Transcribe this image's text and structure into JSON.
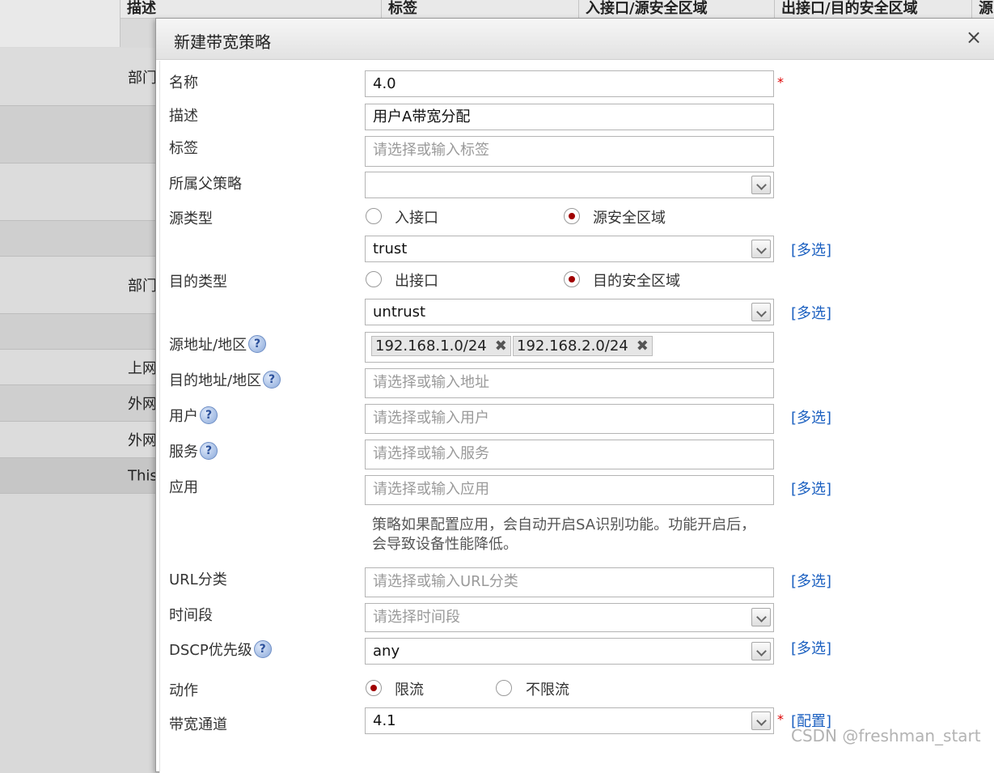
{
  "background_table": {
    "headers": [
      "描述",
      "标签",
      "入接口/源安全区域",
      "出接口/目的安全区域",
      "源"
    ],
    "rows": [
      {
        "text": ""
      },
      {
        "text": "部门"
      },
      {
        "text": ""
      },
      {
        "text": ""
      },
      {
        "text": ""
      },
      {
        "text": "部门"
      },
      {
        "text": ""
      },
      {
        "text": "上网"
      },
      {
        "text": "外网"
      },
      {
        "text": "外网"
      },
      {
        "text": "This"
      }
    ]
  },
  "dialog": {
    "title": "新建带宽策略",
    "close_glyph": "×"
  },
  "form": {
    "name": {
      "label": "名称",
      "value": "4.0",
      "required": "*"
    },
    "description": {
      "label": "描述",
      "value": "用户A带宽分配"
    },
    "tags": {
      "label": "标签",
      "placeholder": "请选择或输入标签"
    },
    "parent_policy": {
      "label": "所属父策略",
      "value": ""
    },
    "source_type": {
      "label": "源类型",
      "options": [
        "入接口",
        "源安全区域"
      ],
      "selected": "源安全区域",
      "zone_value": "trust",
      "multi_link": "[多选]"
    },
    "dest_type": {
      "label": "目的类型",
      "options": [
        "出接口",
        "目的安全区域"
      ],
      "selected": "目的安全区域",
      "zone_value": "untrust",
      "multi_link": "[多选]"
    },
    "source_address": {
      "label": "源地址/地区",
      "tags": [
        "192.168.1.0/24",
        "192.168.2.0/24"
      ],
      "remove_glyph": "✖"
    },
    "dest_address": {
      "label": "目的地址/地区",
      "placeholder": "请选择或输入地址"
    },
    "user": {
      "label": "用户",
      "placeholder": "请选择或输入用户",
      "multi_link": "[多选]"
    },
    "service": {
      "label": "服务",
      "placeholder": "请选择或输入服务"
    },
    "application": {
      "label": "应用",
      "placeholder": "请选择或输入应用",
      "multi_link": "[多选]",
      "note": "策略如果配置应用，会自动开启SA识别功能。功能开启后，会导致设备性能降低。"
    },
    "url_category": {
      "label": "URL分类",
      "placeholder": "请选择或输入URL分类",
      "multi_link": "[多选]"
    },
    "time_range": {
      "label": "时间段",
      "placeholder": "请选择时间段"
    },
    "dscp": {
      "label": "DSCP优先级",
      "value": "any",
      "multi_link": "[多选]"
    },
    "action": {
      "label": "动作",
      "options": [
        "限流",
        "不限流"
      ],
      "selected": "限流"
    },
    "bandwidth_channel": {
      "label": "带宽通道",
      "value": "4.1",
      "required": "*",
      "config_link": "[配置]"
    },
    "help_glyph": "?"
  },
  "watermark": "CSDN @freshman_start"
}
